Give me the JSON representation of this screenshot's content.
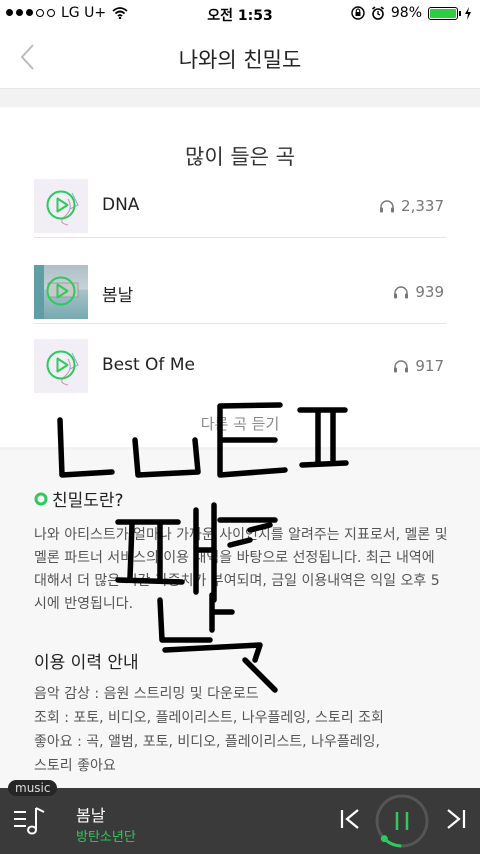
{
  "status": {
    "carrier": "LG U+",
    "time": "오전 1:53",
    "battery": "98%",
    "battery_level": 0.98
  },
  "nav": {
    "title": "나와의 친밀도",
    "back_icon": "chevron-left-icon"
  },
  "top_songs": {
    "title": "많이 들은 곡",
    "songs": [
      {
        "title": "DNA",
        "plays": "2,337"
      },
      {
        "title": "봄날",
        "plays": "939"
      },
      {
        "title": "Best Of Me",
        "plays": "917"
      }
    ],
    "more_label": "다른 곡 듣기"
  },
  "info": {
    "heading": "친밀도란?",
    "body": "나와 아티스트가 얼마나 가까운 사이인지를 알려주는 지표로서, 멜론 및 멜론 파트너 서비스의 이용 내역을 바탕으로 선정됩니다. 최근 내역에 대해서 더 많은 시간 가중치가 부여되며, 금일 이용내역은 익일 오후 5시에 반영됩니다.",
    "usage_heading": "이용 이력 안내",
    "usage_lines": [
      "음악 감상 : 음원 스트리밍 및 다운로드",
      "조회 : 포토, 비디오, 플레이리스트, 나우플레잉, 스토리 조회",
      "좋아요 : 곡, 앨범, 포토, 비디오, 플레이리스트, 나우플레잉,",
      "스토리 좋아요"
    ]
  },
  "player": {
    "tag": "music",
    "title": "봄날",
    "artist": "방탄소년단",
    "accent": "#2fc95c",
    "progress": 0.12
  },
  "colors": {
    "accent": "#2fc95c",
    "player_bg": "#3a3a3a",
    "scribble": "#000000"
  }
}
